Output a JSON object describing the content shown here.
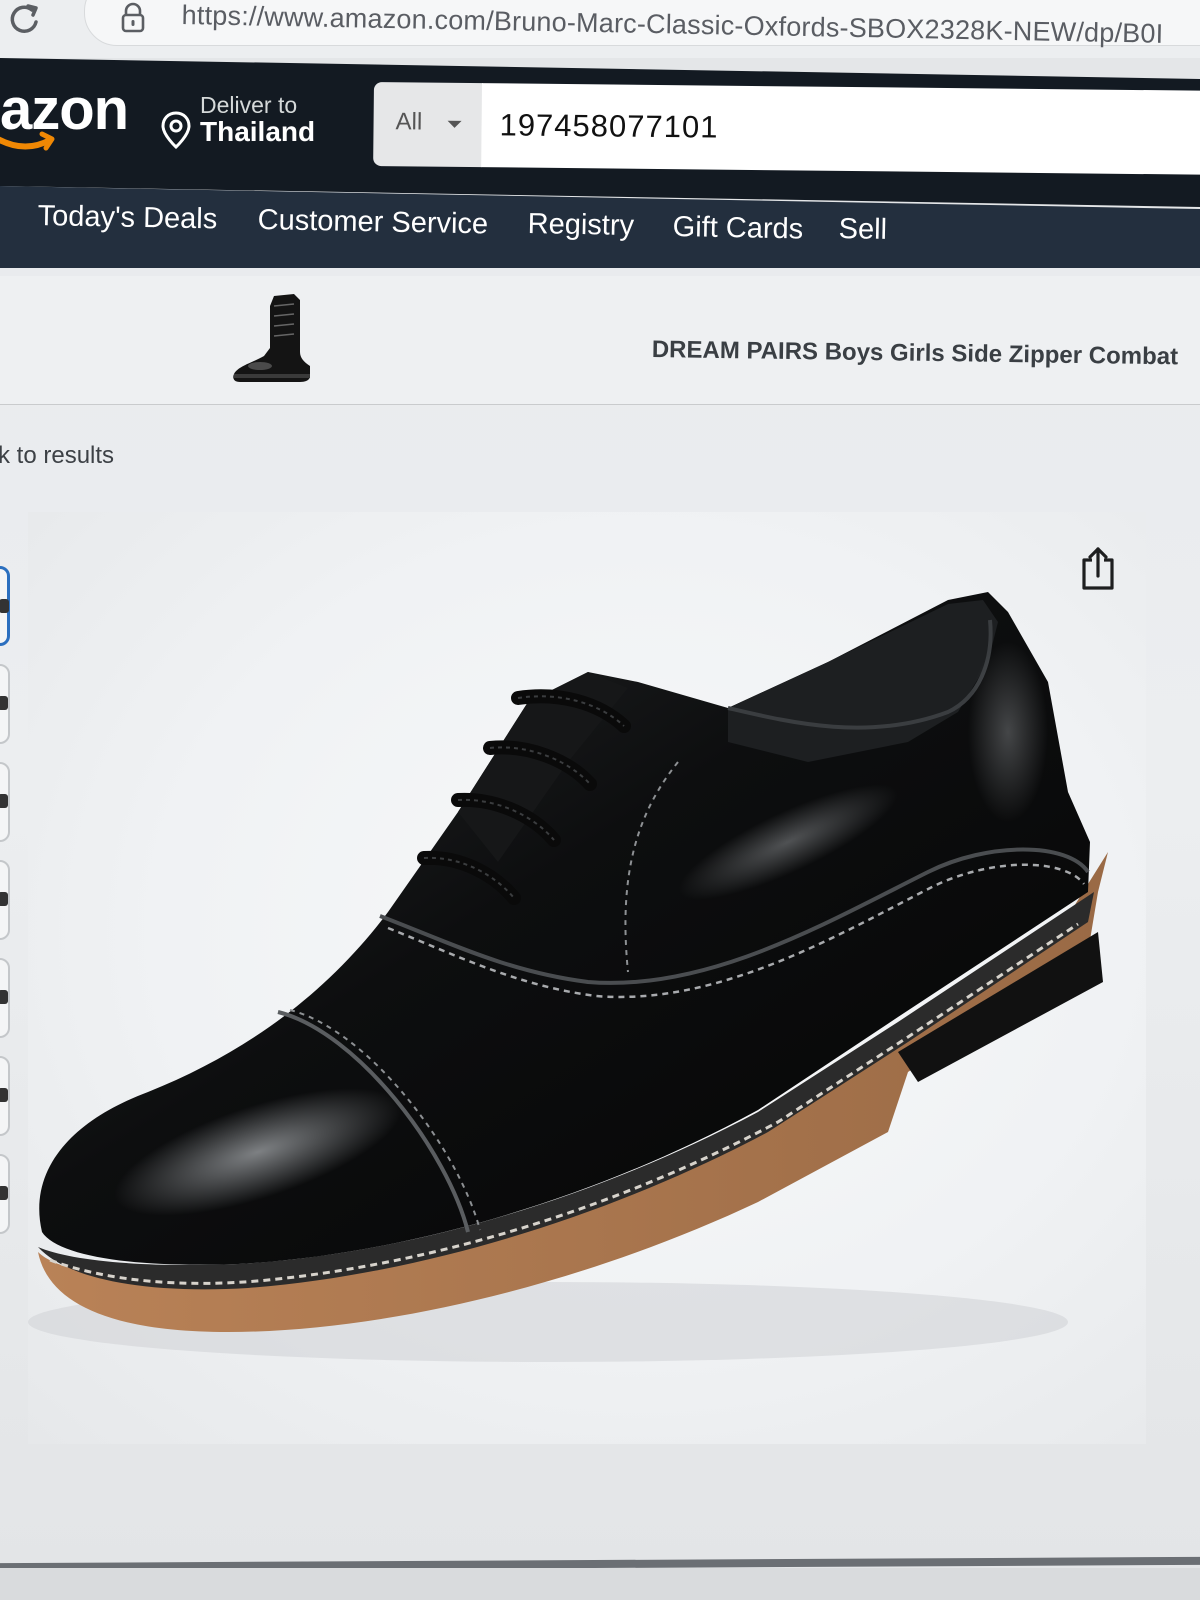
{
  "browser": {
    "url": "https://www.amazon.com/Bruno-Marc-Classic-Oxfords-SBOX2328K-NEW/dp/B0I"
  },
  "header": {
    "logo_text": "azon",
    "deliver_label": "Deliver to",
    "deliver_country": "Thailand",
    "search": {
      "department": "All",
      "query": "197458077101"
    }
  },
  "subnav": {
    "items": [
      "Today's Deals",
      "Customer Service",
      "Registry",
      "Gift Cards",
      "Sell"
    ]
  },
  "sponsored": {
    "title": "DREAM PAIRS Boys Girls Side Zipper Combat"
  },
  "page": {
    "back_link": "k to results"
  },
  "icons": [
    "reload-icon",
    "lock-icon",
    "location-pin-icon",
    "share-icon"
  ],
  "colors": {
    "nav_dark": "#131a22",
    "subnav": "#232f3e",
    "logo_smile": "#f08804",
    "thumb_active": "#2b6fbf"
  }
}
